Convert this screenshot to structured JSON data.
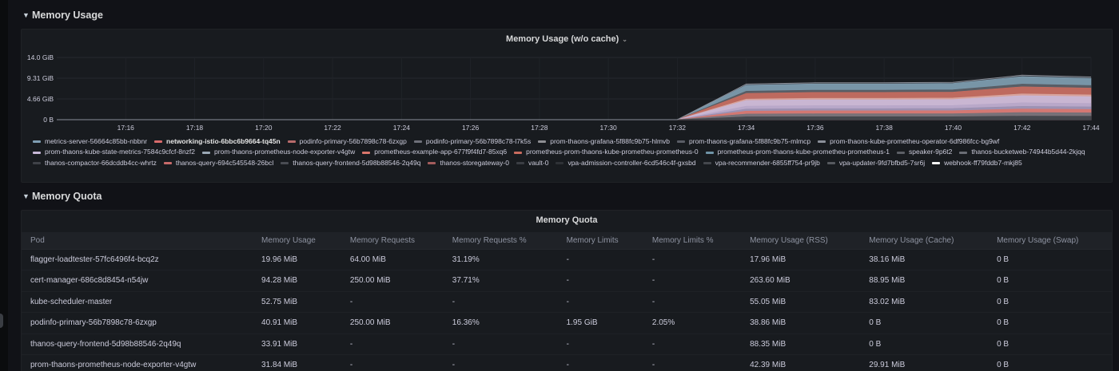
{
  "top_cut": [
    "1000000  1000000 10000",
    "",
    "",
    "",
    ""
  ],
  "memory_usage_row": {
    "title": "Memory Usage",
    "chevron": "chevron-down-icon"
  },
  "memory_chart_panel": {
    "title": "Memory Usage (w/o cache)",
    "chart_data": {
      "type": "area",
      "stacked": true,
      "title": "Memory Usage (w/o cache)",
      "y_ticks": [
        "14.0 GiB",
        "9.31 GiB",
        "4.66 GiB",
        "0 B"
      ],
      "ylim_gib": [
        0,
        14.0
      ],
      "x": [
        "17:14",
        "17:16",
        "17:18",
        "17:20",
        "17:22",
        "17:24",
        "17:26",
        "17:28",
        "17:30",
        "17:32",
        "17:34",
        "17:36",
        "17:38",
        "17:40",
        "17:42",
        "17:44"
      ],
      "x_ticks": [
        "17:16",
        "17:18",
        "17:20",
        "17:22",
        "17:24",
        "17:26",
        "17:28",
        "17:30",
        "17:32",
        "17:34",
        "17:36",
        "17:38",
        "17:40",
        "17:42",
        "17:44"
      ],
      "total_gib": [
        0,
        0,
        0,
        0,
        0,
        0,
        0,
        0,
        0,
        0,
        8.0,
        8.3,
        8.3,
        8.4,
        10.0,
        9.6
      ],
      "grid": true,
      "legend_position": "bottom"
    },
    "legend": [
      {
        "name": "metrics-server-56664c85bb-nbbnr",
        "color": "#7f9eb3"
      },
      {
        "name": "networking-istio-6bbc6b9664-tq45n",
        "color": "#d96b6b",
        "bold": true
      },
      {
        "name": "podinfo-primary-56b7898c78-6zxgp",
        "color": "#b86b6b"
      },
      {
        "name": "podinfo-primary-56b7898c78-l7k5s",
        "color": "#6e7079"
      },
      {
        "name": "prom-thaons-grafana-5f88fc9b75-hlmvb",
        "color": "#8e8e93"
      },
      {
        "name": "prom-thaons-grafana-5f88fc9b75-mlmcp",
        "color": "#5a5d66"
      },
      {
        "name": "prom-thaons-kube-prometheu-operator-6df986fcc-bg9wf",
        "color": "#8a8f99"
      },
      {
        "name": "prom-thaons-kube-state-metrics-7584c9cfcf-8nzf2",
        "color": "#c8b8d8"
      },
      {
        "name": "prom-thaons-prometheus-node-exporter-v4gtw",
        "color": "#9aa7b5"
      },
      {
        "name": "prometheus-example-app-677f9f4fd7-85xq6",
        "color": "#d9756b"
      },
      {
        "name": "prometheus-prom-thaons-kube-prometheu-prometheus-0",
        "color": "#c96b5e"
      },
      {
        "name": "prometheus-prom-thaons-kube-prometheu-prometheus-1",
        "color": "#6f93a6"
      },
      {
        "name": "speaker-9p6t2",
        "color": "#5c5f66"
      },
      {
        "name": "thanos-bucketweb-74944b5d44-2kjqq",
        "color": "#6a6d75"
      },
      {
        "name": "thanos-compactor-66dcddb4cc-whrtz",
        "color": "#3f4248"
      },
      {
        "name": "thanos-query-694c545548-26bcl",
        "color": "#c76a6a"
      },
      {
        "name": "thanos-query-frontend-5d98b88546-2q49q",
        "color": "#4a4d54"
      },
      {
        "name": "thanos-storegateway-0",
        "color": "#a35c5c"
      },
      {
        "name": "vault-0",
        "color": "#3b3e44"
      },
      {
        "name": "vpa-admission-controller-6cd546c4f-gxsbd",
        "color": "#2f3237"
      },
      {
        "name": "vpa-recommender-6855ff754-pr9jb",
        "color": "#44474d"
      },
      {
        "name": "vpa-updater-9fd7bfbd5-7sr6j",
        "color": "#56595f"
      },
      {
        "name": "webhook-ff79fddb7-mkj85",
        "color": "#f2f2f2"
      }
    ]
  },
  "memory_quota_row": {
    "title": "Memory Quota",
    "chevron": "chevron-down-icon"
  },
  "memory_quota_panel": {
    "title": "Memory Quota",
    "columns": [
      "Pod",
      "Memory Usage",
      "Memory Requests",
      "Memory Requests %",
      "Memory Limits",
      "Memory Limits %",
      "Memory Usage (RSS)",
      "Memory Usage (Cache)",
      "Memory Usage (Swap)"
    ],
    "rows": [
      [
        "flagger-loadtester-57fc6496f4-bcq2z",
        "19.96 MiB",
        "64.00 MiB",
        "31.19%",
        "-",
        "-",
        "17.96 MiB",
        "38.16 MiB",
        "0 B"
      ],
      [
        "cert-manager-686c8d8454-n54jw",
        "94.28 MiB",
        "250.00 MiB",
        "37.71%",
        "-",
        "-",
        "263.60 MiB",
        "88.95 MiB",
        "0 B"
      ],
      [
        "kube-scheduler-master",
        "52.75 MiB",
        "-",
        "-",
        "-",
        "-",
        "55.05 MiB",
        "83.02 MiB",
        "0 B"
      ],
      [
        "podinfo-primary-56b7898c78-6zxgp",
        "40.91 MiB",
        "250.00 MiB",
        "16.36%",
        "1.95 GiB",
        "2.05%",
        "38.86 MiB",
        "0 B",
        "0 B"
      ],
      [
        "thanos-query-frontend-5d98b88546-2q49q",
        "33.91 MiB",
        "-",
        "-",
        "-",
        "-",
        "88.35 MiB",
        "0 B",
        "0 B"
      ],
      [
        "prom-thaons-prometheus-node-exporter-v4gtw",
        "31.84 MiB",
        "-",
        "-",
        "-",
        "-",
        "42.39 MiB",
        "29.91 MiB",
        "0 B"
      ]
    ]
  }
}
